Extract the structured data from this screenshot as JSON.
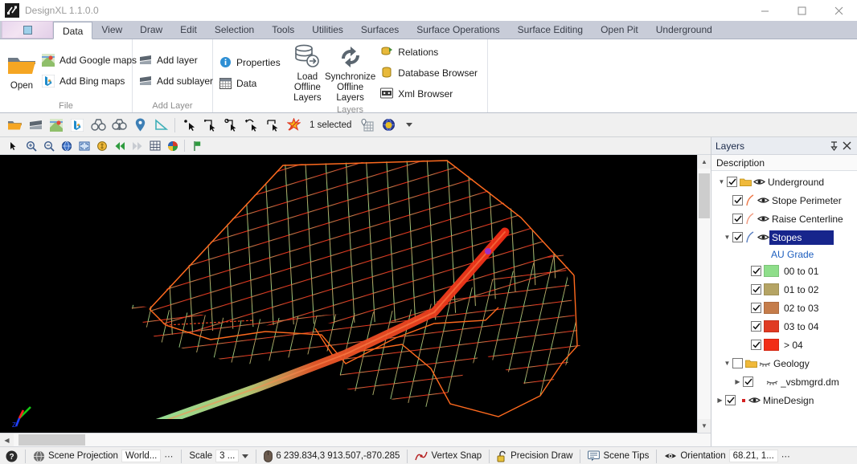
{
  "window": {
    "title": "DesignXL 1.1.0.0",
    "app_icon": "hammers-icon",
    "minimize": "—",
    "maximize": "□",
    "close": "✕"
  },
  "ribbon": {
    "tabs": [
      {
        "label": "Data",
        "active": true
      },
      {
        "label": "View",
        "active": false
      },
      {
        "label": "Draw",
        "active": false
      },
      {
        "label": "Edit",
        "active": false
      },
      {
        "label": "Selection",
        "active": false
      },
      {
        "label": "Tools",
        "active": false
      },
      {
        "label": "Utilities",
        "active": false
      },
      {
        "label": "Surfaces",
        "active": false
      },
      {
        "label": "Surface Operations",
        "active": false
      },
      {
        "label": "Surface Editing",
        "active": false
      },
      {
        "label": "Open Pit",
        "active": false
      },
      {
        "label": "Underground",
        "active": false
      }
    ],
    "groups": [
      {
        "name": "File",
        "label": "File",
        "big": [
          {
            "label": "Open",
            "icon": "open-folder-icon"
          }
        ],
        "small": [
          {
            "label": "Add Google maps",
            "icon": "google-maps-icon"
          },
          {
            "label": "Add Bing maps",
            "icon": "bing-maps-icon"
          }
        ]
      },
      {
        "name": "Add Layer",
        "label": "Add Layer",
        "big": [],
        "small": [
          {
            "label": "Add layer",
            "icon": "layer-icon"
          },
          {
            "label": "Add sublayer",
            "icon": "sublayer-icon"
          }
        ]
      },
      {
        "name": "Layers",
        "label": "Layers",
        "big": [
          {
            "label": "Load Offline Layers",
            "icon": "load-offline-layers-icon"
          },
          {
            "label": "Synchronize Offline Layers",
            "icon": "synchronize-icon"
          }
        ],
        "small": [
          {
            "label": "Properties",
            "icon": "properties-info-icon"
          },
          {
            "label": "Data",
            "icon": "data-table-icon"
          },
          {
            "label": "Relations",
            "icon": "relations-icon"
          },
          {
            "label": "Database Browser",
            "icon": "database-browser-icon"
          },
          {
            "label": "Xml Browser",
            "icon": "xml-browser-icon"
          }
        ]
      }
    ]
  },
  "toolbar_main": {
    "selected_count_label": "1 selected",
    "items": [
      {
        "icon": "open-folder-icon",
        "name": "open"
      },
      {
        "icon": "layer-icon",
        "name": "add-layer"
      },
      {
        "icon": "google-maps-icon",
        "name": "add-google-maps"
      },
      {
        "icon": "bing-maps-icon",
        "name": "add-bing-maps"
      },
      {
        "icon": "binoculars-icon",
        "name": "view-1"
      },
      {
        "icon": "binoculars-anchor-icon",
        "name": "view-2"
      },
      {
        "icon": "map-pin-icon",
        "name": "place-marker"
      },
      {
        "icon": "triangle-ruler-icon",
        "name": "measure"
      },
      {
        "icon": "select-point-icon",
        "name": "select-point"
      },
      {
        "icon": "select-polygon-icon",
        "name": "select-polygon"
      },
      {
        "icon": "select-add-icon",
        "name": "select-add"
      },
      {
        "icon": "select-subtract-icon",
        "name": "select-subtract"
      },
      {
        "icon": "select-rectangle-icon",
        "name": "select-rectangle"
      },
      {
        "icon": "clear-selection-icon",
        "name": "clear-selection"
      }
    ],
    "trailing": [
      {
        "icon": "grid-pin-icon",
        "name": "grid-pin"
      },
      {
        "icon": "globe-highlight-icon",
        "name": "globe-highlight"
      },
      {
        "icon": "chevron-down-icon",
        "name": "overflow"
      }
    ]
  },
  "toolbar_view": {
    "items": [
      {
        "icon": "arrow-cursor-icon",
        "name": "pointer"
      },
      {
        "icon": "zoom-in-icon",
        "name": "zoom-in"
      },
      {
        "icon": "zoom-out-icon",
        "name": "zoom-out"
      },
      {
        "icon": "globe-blue-icon",
        "name": "zoom-extents"
      },
      {
        "icon": "zoom-window-icon",
        "name": "zoom-window"
      },
      {
        "icon": "coin-icon",
        "name": "rotate"
      },
      {
        "icon": "rewind-icon",
        "name": "previous-view"
      },
      {
        "icon": "forward-icon",
        "name": "next-view"
      },
      {
        "icon": "grid-icon",
        "name": "grid"
      },
      {
        "icon": "palette-icon",
        "name": "colors"
      },
      {
        "icon": "flag-icon",
        "name": "bookmark"
      }
    ]
  },
  "viewport": {
    "background": "#000000",
    "axes": {
      "x_color": "#ff2020",
      "y_color": "#14c814",
      "z_color": "#2040ff"
    },
    "scene_description": "3D wireframe stope surface mesh shaded by AU grade with raise centerline tube"
  },
  "layers_panel": {
    "title": "Layers",
    "pin_icon": "pin-icon",
    "close_icon": "close-icon",
    "column_header": "Description",
    "tree": [
      {
        "label": "Underground",
        "indent": 0,
        "expander": "down",
        "checked": true,
        "icons": [
          "folder-icon",
          "eye-icon"
        ],
        "selected": false,
        "type": "group"
      },
      {
        "label": "Stope Perimeter",
        "indent": 1,
        "expander": "none",
        "checked": true,
        "icons": [
          "curve-orange-icon",
          "eye-icon"
        ],
        "selected": false,
        "type": "layer"
      },
      {
        "label": "Raise Centerline",
        "indent": 1,
        "expander": "none",
        "checked": true,
        "icons": [
          "curve-salmon-icon",
          "eye-icon"
        ],
        "selected": false,
        "type": "layer"
      },
      {
        "label": "Stopes",
        "indent": 1,
        "expander": "down",
        "checked": true,
        "icons": [
          "curve-blue-icon",
          "eye-icon"
        ],
        "selected": true,
        "type": "layer"
      },
      {
        "label": "AU Grade",
        "indent": 2,
        "expander": "none",
        "checked": null,
        "icons": [],
        "selected": false,
        "type": "attribute"
      },
      {
        "label": "00 to 01",
        "indent": 2,
        "expander": "none",
        "checked": true,
        "swatch": "#8ede8a",
        "selected": false,
        "type": "legend"
      },
      {
        "label": "01 to 02",
        "indent": 2,
        "expander": "none",
        "checked": true,
        "swatch": "#b5a464",
        "selected": false,
        "type": "legend"
      },
      {
        "label": "02 to 03",
        "indent": 2,
        "expander": "none",
        "checked": true,
        "swatch": "#c57c4a",
        "selected": false,
        "type": "legend"
      },
      {
        "label": "03 to 04",
        "indent": 2,
        "expander": "none",
        "checked": true,
        "swatch": "#e03a22",
        "selected": false,
        "type": "legend"
      },
      {
        "label": "> 04",
        "indent": 2,
        "expander": "none",
        "checked": true,
        "swatch": "#f22d16",
        "selected": false,
        "type": "legend"
      },
      {
        "label": "Geology",
        "indent": 1,
        "expander": "down",
        "checked": false,
        "icons": [
          "folder-icon",
          "eye-off-icon"
        ],
        "selected": false,
        "type": "group"
      },
      {
        "label": "_vsbmgrd.dm",
        "indent": 2,
        "expander": "right",
        "checked": true,
        "icons": [
          "eye-off-icon"
        ],
        "selected": false,
        "type": "layer"
      },
      {
        "label": "MineDesign",
        "indent": 0,
        "expander": "right",
        "checked": true,
        "icons": [
          "dot-red-icon",
          "eye-icon"
        ],
        "selected": false,
        "type": "group"
      }
    ]
  },
  "status_bar": {
    "help_icon": "help-icon",
    "scene_projection_label": "Scene Projection",
    "scene_projection_value": "World...",
    "scene_projection_more": "⋯",
    "scale_label": "Scale",
    "scale_value": "3 ...",
    "coordinates_icon": "mouse-icon",
    "coordinates": "6 239.834,3 913.507,-870.285",
    "vertex_snap_label": "Vertex Snap",
    "vertex_snap_icon": "vertex-snap-icon",
    "precision_draw_label": "Precision Draw",
    "precision_draw_icon": "lock-open-icon",
    "scene_tips_label": "Scene Tips",
    "scene_tips_icon": "tooltip-icon",
    "orientation_label": "Orientation",
    "orientation_icon": "eye-icon",
    "orientation_value": "68.21, 1...",
    "orientation_more": "⋯"
  }
}
